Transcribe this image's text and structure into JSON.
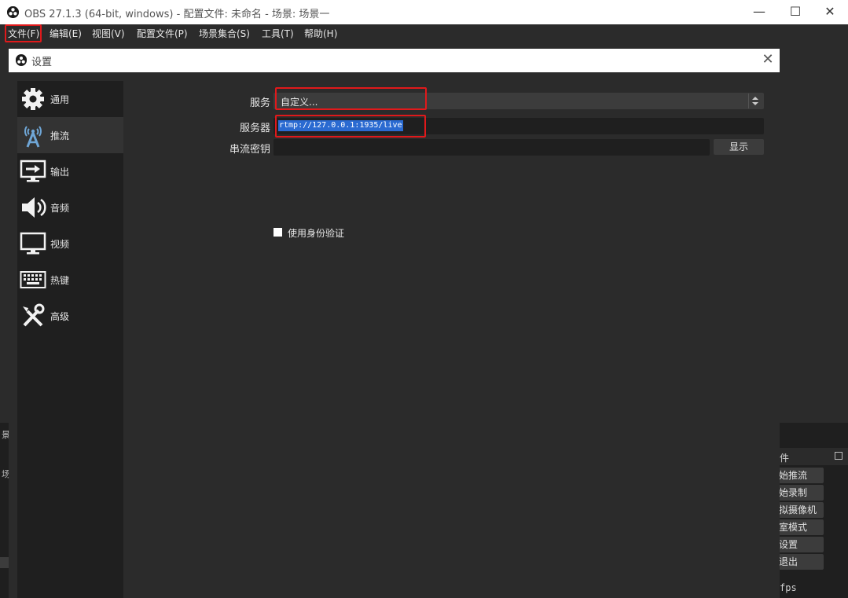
{
  "window": {
    "title": "OBS 27.1.3 (64-bit, windows) - 配置文件: 未命名 - 场景: 场景一",
    "min_glyph": "—",
    "max_glyph": "☐",
    "close_glyph": "✕"
  },
  "menubar": {
    "items": [
      "文件(F)",
      "编辑(E)",
      "视图(V)",
      "配置文件(P)",
      "场景集合(S)",
      "工具(T)",
      "帮助(H)"
    ]
  },
  "settings": {
    "title": "设置",
    "close_glyph": "✕",
    "nav": [
      {
        "label": "通用",
        "icon": "gear-icon"
      },
      {
        "label": "推流",
        "icon": "broadcast-antenna-icon",
        "active": true
      },
      {
        "label": "输出",
        "icon": "output-monitor-arrow-icon"
      },
      {
        "label": "音频",
        "icon": "speaker-icon"
      },
      {
        "label": "视频",
        "icon": "monitor-icon"
      },
      {
        "label": "热键",
        "icon": "keyboard-icon"
      },
      {
        "label": "高级",
        "icon": "tools-icon"
      }
    ],
    "stream": {
      "service_label": "服务",
      "service_value": "自定义...",
      "server_label": "服务器",
      "server_value": "rtmp://127.0.0.1:1935/live",
      "key_label": "串流密钥",
      "key_value": "",
      "show_button": "显示",
      "auth_label": "使用身份验证",
      "auth_checked": false
    }
  },
  "background": {
    "dock_title": "件",
    "controls": [
      "始推流",
      "始录制",
      "拟摄像机",
      "室模式",
      "设置",
      "退出"
    ],
    "fps": "fps",
    "left_a": "景",
    "left_b": "场"
  },
  "colors": {
    "highlight": "#e0191b",
    "selection": "#2a6ad1"
  }
}
